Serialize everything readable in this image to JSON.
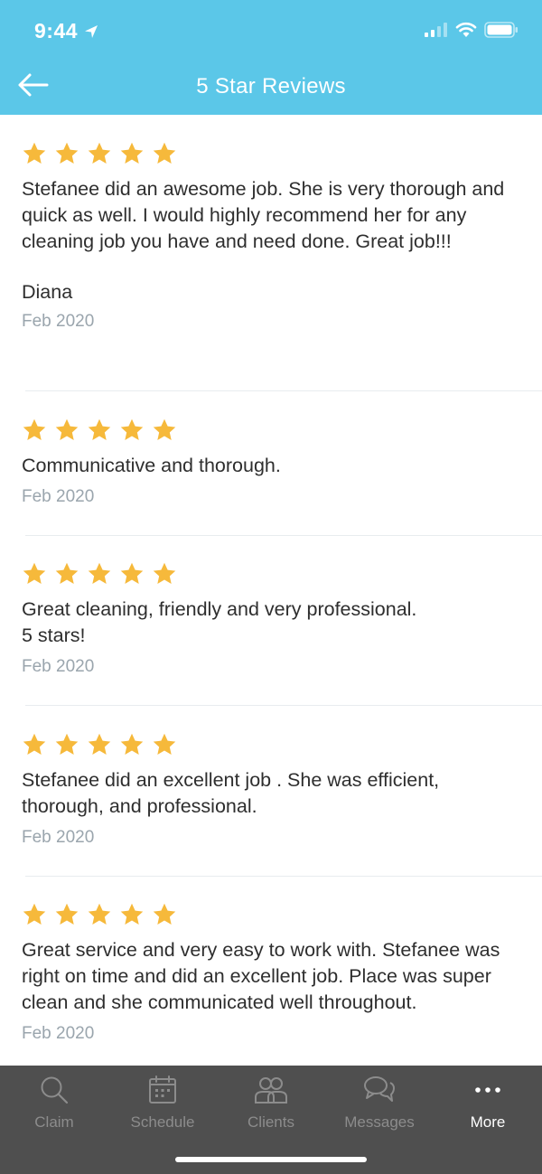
{
  "status_bar": {
    "time": "9:44"
  },
  "nav": {
    "title": "5 Star Reviews"
  },
  "colors": {
    "header": "#5bc7e8",
    "star": "#f6b93b",
    "tabbar": "#4f4f4f",
    "date": "#9aa5ad"
  },
  "reviews": [
    {
      "rating": 5,
      "text": "Stefanee did an awesome job. She is very thorough and quick as well. I would highly recommend her for any cleaning job you have and need done. Great job!!!",
      "reviewer": "Diana",
      "date": "Feb 2020"
    },
    {
      "rating": 5,
      "text": "Communicative and thorough.",
      "date": "Feb 2020"
    },
    {
      "rating": 5,
      "text": "Great cleaning, friendly and very professional.\n5 stars!",
      "date": "Feb 2020"
    },
    {
      "rating": 5,
      "text": "Stefanee did an excellent job . She was efficient, thorough, and professional.",
      "date": "Feb 2020"
    },
    {
      "rating": 5,
      "text": "Great service and very easy to work with. Stefanee was right on time and did an excellent job. Place was super clean and she communicated well throughout.",
      "date": "Feb 2020"
    }
  ],
  "tabs": [
    {
      "label": "Claim",
      "icon": "search-icon"
    },
    {
      "label": "Schedule",
      "icon": "calendar-icon"
    },
    {
      "label": "Clients",
      "icon": "clients-icon"
    },
    {
      "label": "Messages",
      "icon": "messages-icon"
    },
    {
      "label": "More",
      "icon": "more-icon",
      "active": true
    }
  ]
}
